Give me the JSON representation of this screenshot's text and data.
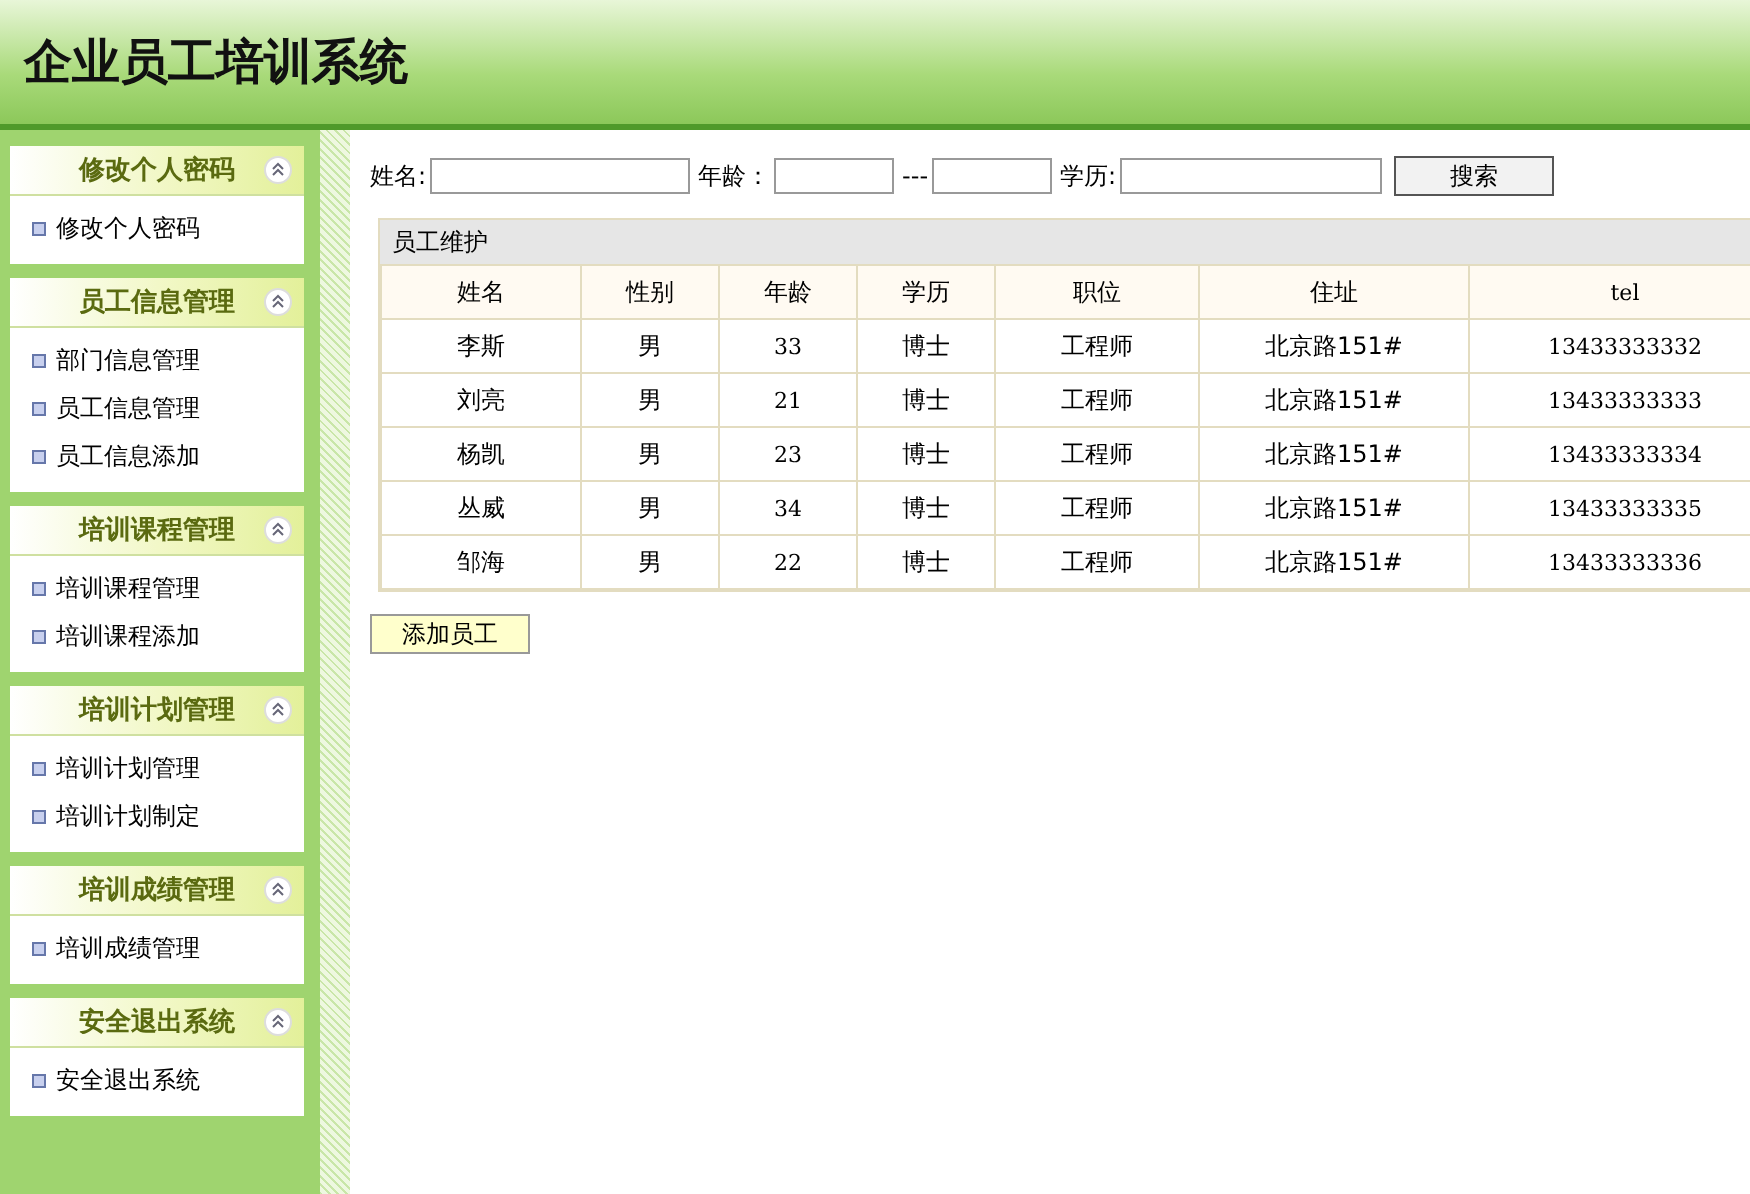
{
  "header": {
    "title": "企业员工培训系统"
  },
  "sidebar": {
    "sections": [
      {
        "title": "修改个人密码",
        "expanded": true,
        "items": [
          "修改个人密码"
        ]
      },
      {
        "title": "员工信息管理",
        "expanded": true,
        "items": [
          "部门信息管理",
          "员工信息管理",
          "员工信息添加"
        ]
      },
      {
        "title": "培训课程管理",
        "expanded": true,
        "items": [
          "培训课程管理",
          "培训课程添加"
        ]
      },
      {
        "title": "培训计划管理",
        "expanded": true,
        "items": [
          "培训计划管理",
          "培训计划制定"
        ]
      },
      {
        "title": "培训成绩管理",
        "expanded": true,
        "items": [
          "培训成绩管理"
        ]
      },
      {
        "title": "安全退出系统",
        "expanded": true,
        "items": [
          "安全退出系统"
        ]
      }
    ]
  },
  "search": {
    "name_label": "姓名:",
    "age_label": "年龄：",
    "age_separator": "---",
    "education_label": "学历:",
    "button": "搜索"
  },
  "table": {
    "caption": "员工维护",
    "columns": [
      "姓名",
      "性别",
      "年龄",
      "学历",
      "职位",
      "住址",
      "tel"
    ],
    "rows": [
      [
        "李斯",
        "男",
        "33",
        "博士",
        "工程师",
        "北京路151#",
        "13433333332"
      ],
      [
        "刘亮",
        "男",
        "21",
        "博士",
        "工程师",
        "北京路151#",
        "13433333333"
      ],
      [
        "杨凯",
        "男",
        "23",
        "博士",
        "工程师",
        "北京路151#",
        "13433333334"
      ],
      [
        "丛威",
        "男",
        "34",
        "博士",
        "工程师",
        "北京路151#",
        "13433333335"
      ],
      [
        "邹海",
        "男",
        "22",
        "博士",
        "工程师",
        "北京路151#",
        "13433333336"
      ]
    ]
  },
  "add_button": "添加员工"
}
